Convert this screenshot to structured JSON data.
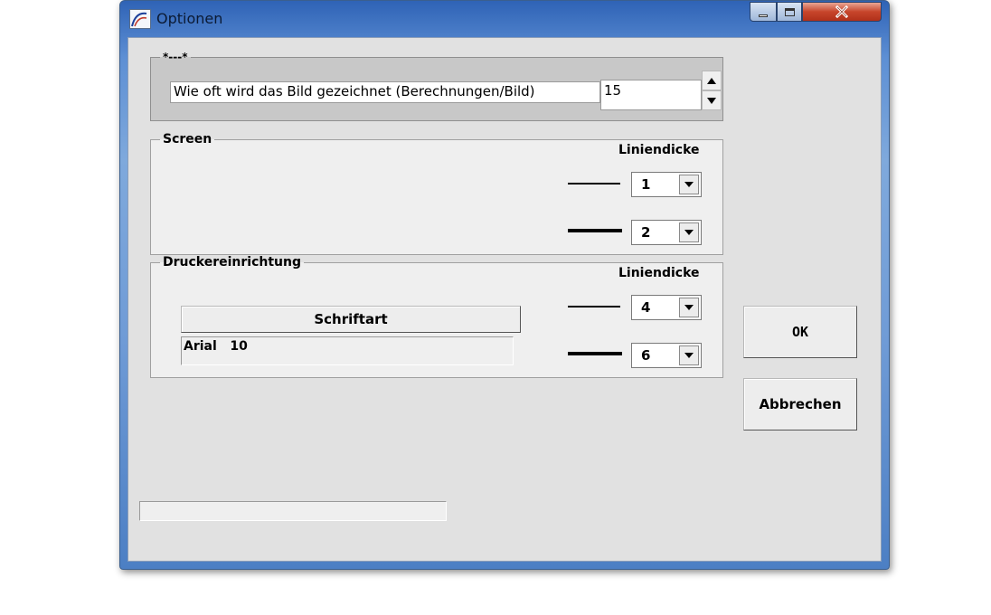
{
  "window": {
    "title": "Optionen",
    "icon": "app-icon",
    "controls": {
      "minimize_icon": "minimize-icon",
      "maximize_icon": "maximize-icon",
      "close_icon": "close-icon"
    }
  },
  "group_top": {
    "legend": "*---*",
    "label": "Wie oft wird das Bild gezeichnet (Berechnungen/Bild)",
    "value": "15",
    "up_icon": "arrow-up-icon",
    "down_icon": "arrow-down-icon"
  },
  "screen": {
    "legend": "Screen",
    "line_width_label": "Liniendicke",
    "thin_value": "1",
    "thick_value": "2"
  },
  "printer": {
    "legend": "Druckereinrichtung",
    "line_width_label": "Liniendicke",
    "font_button_label": "Schriftart",
    "font_display": "Arial   10",
    "thin_value": "4",
    "thick_value": "6"
  },
  "buttons": {
    "ok_label": "OK",
    "cancel_label": "Abbrechen"
  },
  "status_bar": {
    "text": ""
  },
  "colors": {
    "title_blue": "#5d8fd4",
    "close_red": "#c7452b",
    "dialog_gray": "#e1e1e1"
  }
}
